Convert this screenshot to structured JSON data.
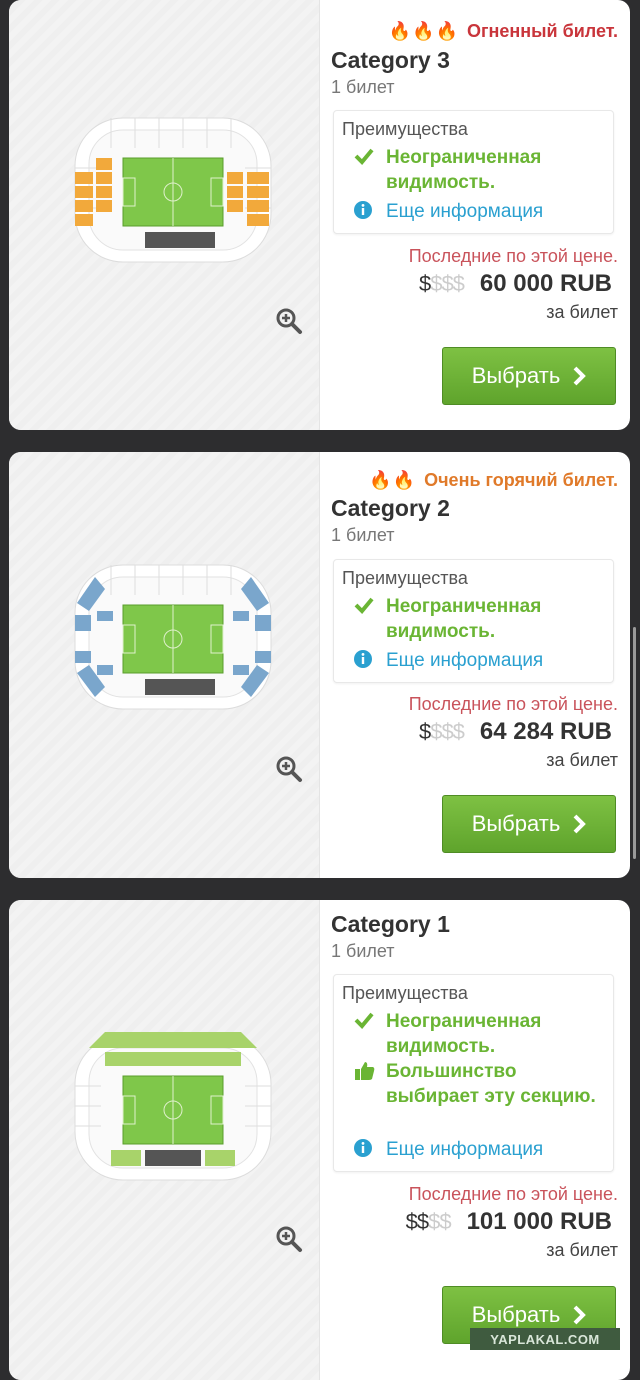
{
  "cards": [
    {
      "heat_label": "Огненный билет.",
      "heat_color": "#c9353b",
      "category": "Category 3",
      "quantity": "1 билет",
      "advantages_title": "Преимущества",
      "advantages": [
        "Неограниченная видимость."
      ],
      "more_info": "Еще информация",
      "last_at_price": "Последние по этой цене.",
      "price_level_active": "$",
      "price_level_dim": "$$$",
      "price": "60 000 RUB",
      "per_ticket": "за билет",
      "select_label": "Выбрать",
      "section_color": "#f2a93b"
    },
    {
      "heat_label": "Очень горячий билет.",
      "heat_color": "#e07a2a",
      "category": "Category 2",
      "quantity": "1 билет",
      "advantages_title": "Преимущества",
      "advantages": [
        "Неограниченная видимость."
      ],
      "more_info": "Еще информация",
      "last_at_price": "Последние по этой цене.",
      "price_level_active": "$",
      "price_level_dim": "$$$",
      "price": "64 284 RUB",
      "per_ticket": "за билет",
      "select_label": "Выбрать",
      "section_color": "#7aa6cc"
    },
    {
      "heat_label": "",
      "category": "Category 1",
      "quantity": "1 билет",
      "advantages_title": "Преимущества",
      "advantages": [
        "Неограниченная видимость.",
        "Большинство выбирает эту секцию."
      ],
      "more_info": "Еще информация",
      "last_at_price": "Последние по этой цене.",
      "price_level_active": "$$",
      "price_level_dim": "$$",
      "price": "101 000 RUB",
      "per_ticket": "за билет",
      "select_label": "Выбрать",
      "section_color": "#a8d36a"
    }
  ],
  "watermark": "YAPLAKAL.COM"
}
